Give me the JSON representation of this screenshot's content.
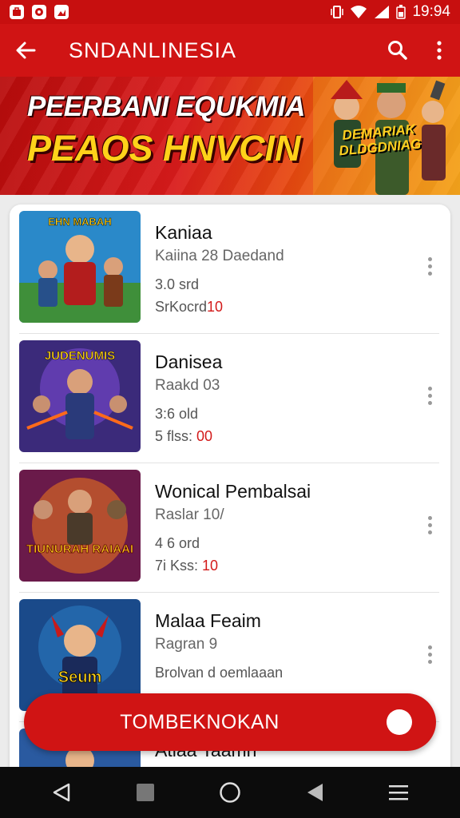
{
  "status_bar": {
    "time": "19:94"
  },
  "app_bar": {
    "title": "SNDANLINESIA"
  },
  "banner": {
    "line1": "PEERBANI EQUKMIA",
    "line2": "PEAOS HNVCIN",
    "badge_line1": "DEMARIAK",
    "badge_line2": "DLDGDNIAG"
  },
  "games": [
    {
      "title": "Kaniaa",
      "subtitle": "Kaiina 28 Daedand",
      "meta1": "3.0 srd",
      "meta2_prefix": "SrKocrd",
      "meta2_highlight": "10",
      "thumb_text": "EHN MABAH"
    },
    {
      "title": "Danisea",
      "subtitle": "Raakd 03",
      "meta1": "3:6 old",
      "meta2_prefix": "5 flss: ",
      "meta2_highlight": "00",
      "thumb_text": "JUDENUMIS"
    },
    {
      "title": "Wonical Pembalsai",
      "subtitle": "Raslar 10/",
      "meta1": "4 6 ord",
      "meta2_prefix": "7i Kss: ",
      "meta2_highlight": "10",
      "thumb_text": "TIUNURAH RAIAAI"
    },
    {
      "title": "Malaa Feaim",
      "subtitle": "Ragran 9",
      "meta1": "Brolvan d oemlaaan",
      "meta2_prefix": "",
      "meta2_highlight": "",
      "thumb_text": "Seum"
    },
    {
      "title": "Atlaa Taamn",
      "subtitle": "",
      "meta1": "",
      "meta2_prefix": "",
      "meta2_highlight": "",
      "thumb_text": ""
    }
  ],
  "fab": {
    "label": "TOMBEKNOKAN"
  },
  "icons": {
    "back": "arrow-back-icon",
    "search": "search-icon",
    "more": "more-vert-icon",
    "nav_back": "nav-back-icon",
    "nav_recent": "nav-recent-icon",
    "nav_home": "nav-home-icon",
    "nav_prev": "nav-prev-icon",
    "nav_menu": "nav-menu-icon"
  },
  "colors": {
    "primary": "#d01414",
    "status_bar": "#c70f0f",
    "accent_yellow": "#ffd21a",
    "highlight_text": "#d31a1a"
  }
}
